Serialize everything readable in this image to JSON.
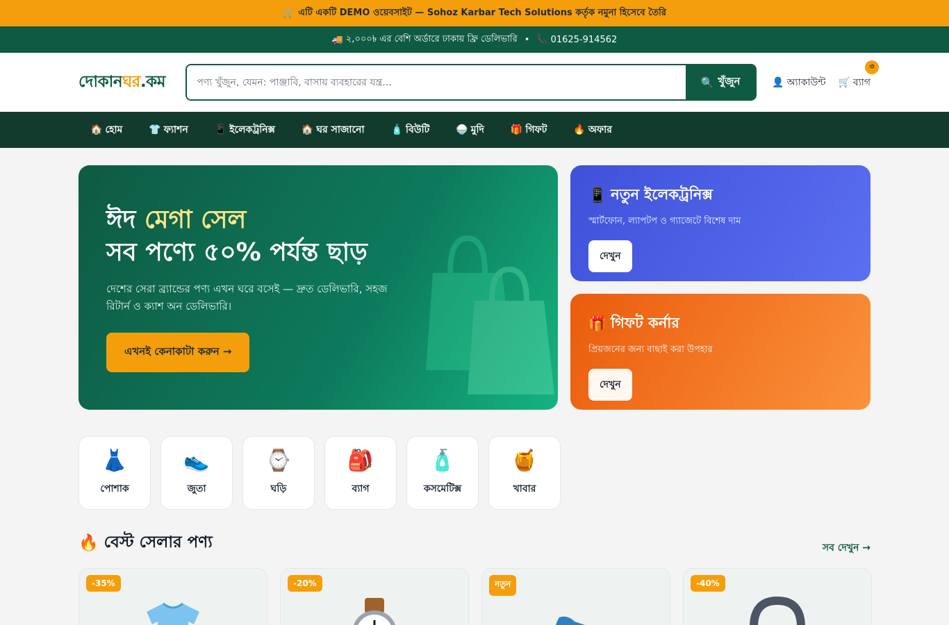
{
  "demo_bar": {
    "icon": "🛒",
    "text": "এটি একটি DEMO ওয়েবসাইট — Sohoz Karbar Tech Solutions কর্তৃক নমুনা হিসেবে তৈরি"
  },
  "info_bar": {
    "truck_icon": "🚚",
    "delivery_text": "২,০০০৳ এর বেশি অর্ডারে ঢাকায় ফ্রি ডেলিভারি",
    "separator": "•",
    "phone_icon": "📞",
    "phone": "01625-914562"
  },
  "header": {
    "logo_main": "দোকান",
    "logo_accent": "ঘর",
    "logo_suffix": ".কম",
    "search_placeholder": "পণ্য খুঁজুন, যেমন: পাঞ্জাবি, বাসায় ব্যবহারের যন্ত্র...",
    "search_icon": "🔍",
    "search_button": "খুঁজুন",
    "account_icon": "👤",
    "account_label": "অ্যাকাউন্ট",
    "cart_icon": "🛒",
    "cart_label": "ব্যাগ",
    "cart_count": "৩"
  },
  "nav": [
    {
      "icon": "🏠",
      "label": "হোম"
    },
    {
      "icon": "👕",
      "label": "ফ্যাশন"
    },
    {
      "icon": "📱",
      "label": "ইলেকট্রনিক্স"
    },
    {
      "icon": "🏠",
      "label": "ঘর সাজানো"
    },
    {
      "icon": "🧴",
      "label": "বিউটি"
    },
    {
      "icon": "🍚",
      "label": "মুদি"
    },
    {
      "icon": "🎁",
      "label": "গিফট"
    },
    {
      "icon": "🔥",
      "label": "অফার"
    }
  ],
  "hero": {
    "title_part1": "ঈদ ",
    "title_highlight": "মেগা সেল",
    "title_line2": "সব পণ্যে ৫০% পর্যন্ত ছাড়",
    "description": "দেশের সেরা ব্র্যান্ডের পণ্য এখন ঘরে বসেই — দ্রুত ডেলিভারি, সহজ রিটার্ন ও ক্যাশ অন ডেলিভারি।",
    "cta": "এখনই কেনাকাটা করুন →"
  },
  "promos": [
    {
      "icon": "📱",
      "title": "নতুন ইলেকট্রনিক্স",
      "subtitle": "স্মার্টফোন, ল্যাপটপ ও গ্যাজেটে বিশেষ দাম",
      "button": "দেখুন"
    },
    {
      "icon": "🎁",
      "title": "গিফট কর্নার",
      "subtitle": "প্রিয়জনের জন্য বাছাই করা উপহার",
      "button": "দেখুন"
    }
  ],
  "categories": [
    {
      "icon": "👗",
      "label": "পোশাক"
    },
    {
      "icon": "👟",
      "label": "জুতা"
    },
    {
      "icon": "⌚",
      "label": "ঘড়ি"
    },
    {
      "icon": "🎒",
      "label": "ব্যাগ"
    },
    {
      "icon": "🧴",
      "label": "কসমেটিক্স"
    },
    {
      "icon": "🍯",
      "label": "খাবার"
    }
  ],
  "best_sellers": {
    "icon": "🔥",
    "title": "বেস্ট সেলার পণ্য",
    "see_all": "সব দেখুন →",
    "products": [
      {
        "badge": "-35%",
        "image": "tshirt-icon"
      },
      {
        "badge": "-20%",
        "image": "watch-icon"
      },
      {
        "badge": "নতুন",
        "image": "sneaker-icon"
      },
      {
        "badge": "-40%",
        "image": "bag-icon"
      }
    ]
  }
}
